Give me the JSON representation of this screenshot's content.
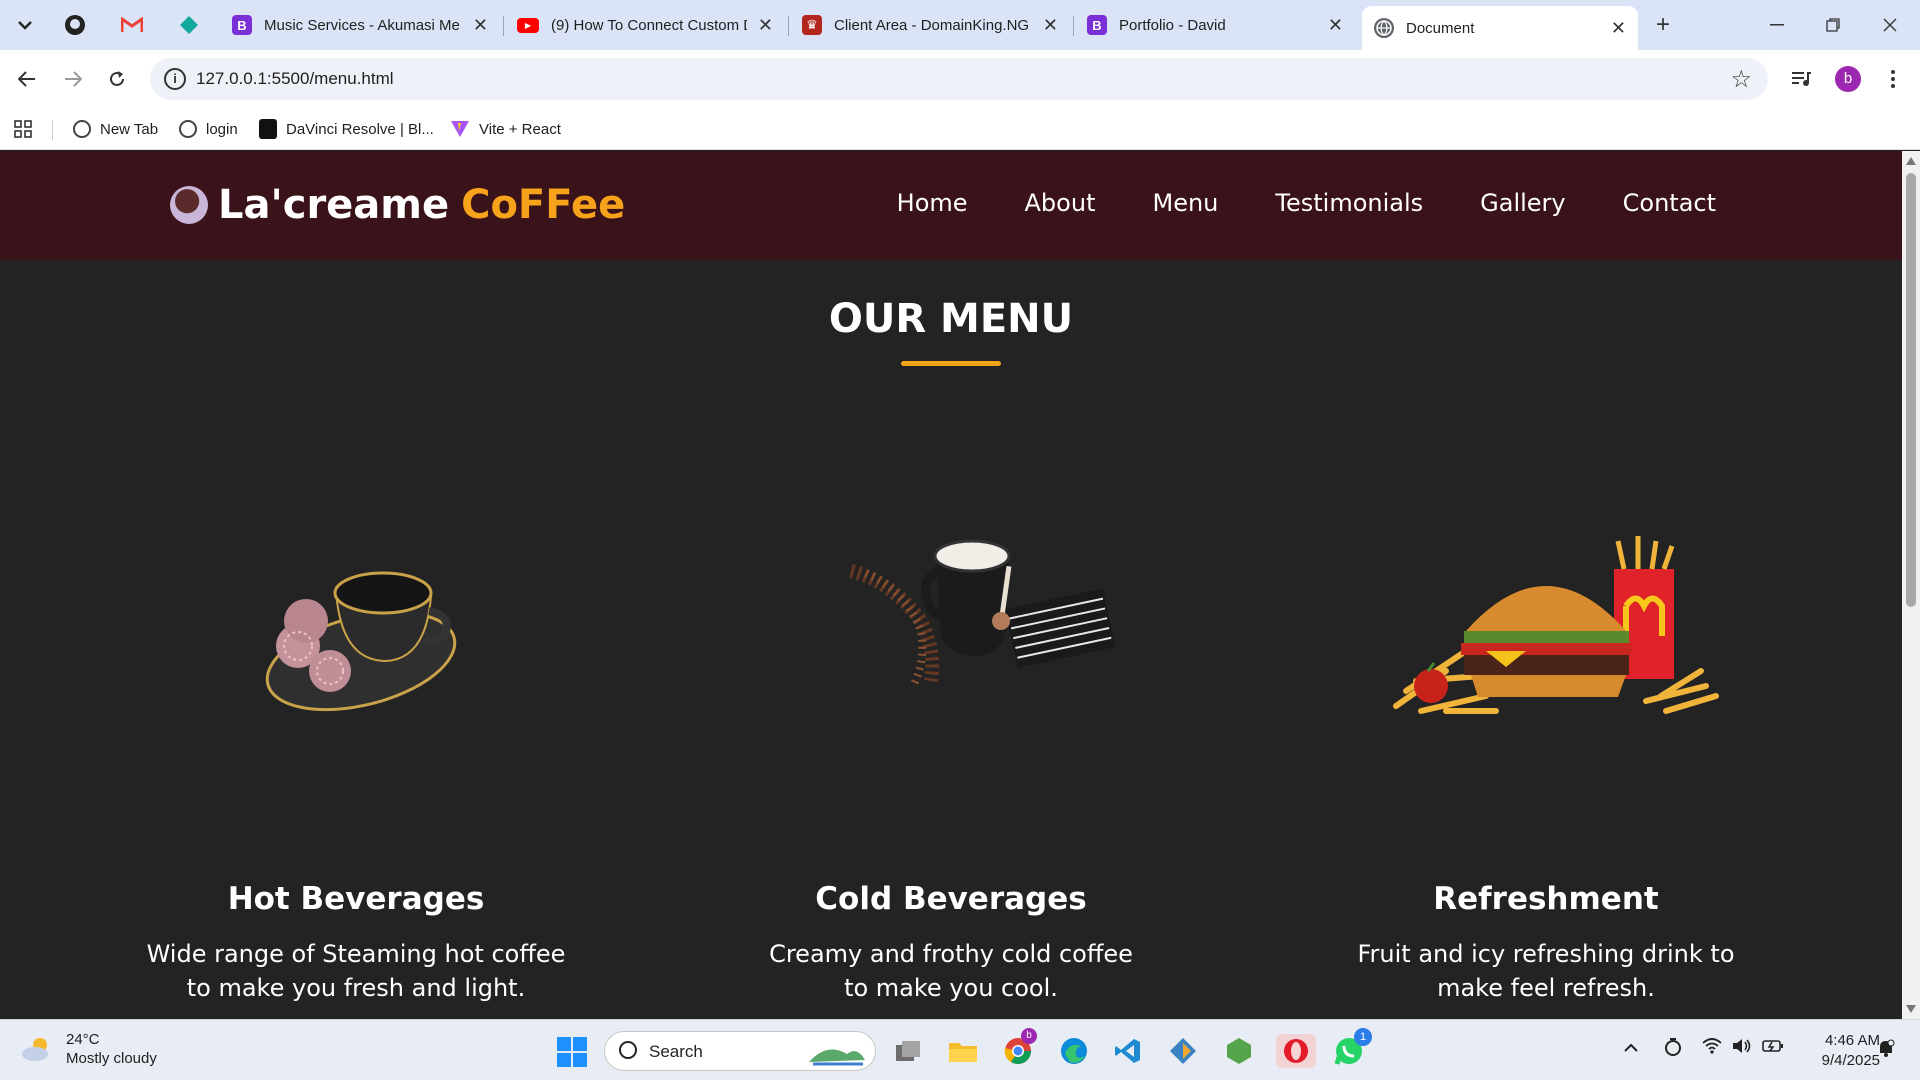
{
  "browser": {
    "tabs": [
      {
        "title": "Music Services - Akumasi Me",
        "favicon": "B",
        "color": "#7b2fd6"
      },
      {
        "title": "(9) How To Connect Custom D",
        "favicon": "▶",
        "color": "#ff0000"
      },
      {
        "title": "Client Area - DomainKing.NG",
        "favicon": "♛",
        "color": "#b3261e"
      },
      {
        "title": "Portfolio - David",
        "favicon": "B",
        "color": "#7b2fd6"
      },
      {
        "title": "Document",
        "favicon": "🌐",
        "color": "#5f6368"
      }
    ],
    "url": "127.0.0.1:5500/menu.html",
    "profile_initial": "b",
    "bookmarks": [
      "New Tab",
      "login",
      "DaVinci Resolve | Bl...",
      "Vite + React"
    ]
  },
  "site": {
    "logo_main": "La'creame",
    "logo_accent": "CoFFee",
    "nav": [
      "Home",
      "About",
      "Menu",
      "Testimonials",
      "Gallery",
      "Contact"
    ],
    "section_title": "OUR MENU",
    "cards": [
      {
        "title": "Hot Beverages",
        "text": "Wide range of Steaming hot coffee to make you fresh and light.",
        "image": "coffee-cup-cookies-image"
      },
      {
        "title": "Cold Beverages",
        "text": "Creamy and frothy cold coffee to make you cool.",
        "image": "coffee-mug-beans-image"
      },
      {
        "title": "Refreshment",
        "text": "Fruit and icy refreshing drink to make feel refresh.",
        "image": "burger-fries-drink-image"
      }
    ],
    "colors": {
      "header_bg": "#3a121a",
      "accent": "#f7a21b",
      "page_bg": "#232323"
    }
  },
  "taskbar": {
    "temperature": "24°C",
    "weather": "Mostly cloudy",
    "search_label": "Search",
    "whatsapp_badge": "1",
    "time": "4:46 AM",
    "date": "9/4/2025"
  }
}
